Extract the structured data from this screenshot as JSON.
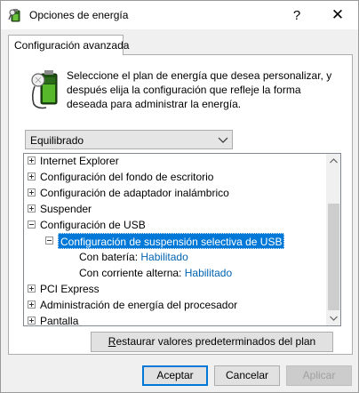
{
  "window": {
    "title": "Opciones de energía",
    "help_glyph": "?",
    "close_glyph": "✕"
  },
  "tab": {
    "label": "Configuración avanzada"
  },
  "description": "Seleccione el plan de energía que desea personalizar, y después elija la configuración que refleje la forma deseada para administrar la energía.",
  "plan_select": {
    "value": "Equilibrado"
  },
  "tree": {
    "items": [
      {
        "label": "Internet Explorer",
        "state": "collapsed"
      },
      {
        "label": "Configuración del fondo de escritorio",
        "state": "collapsed"
      },
      {
        "label": "Configuración de adaptador inalámbrico",
        "state": "collapsed"
      },
      {
        "label": "Suspender",
        "state": "collapsed"
      },
      {
        "label": "Configuración de USB",
        "state": "expanded"
      },
      {
        "label": "Configuración de suspensión selectiva de USB",
        "state": "expanded",
        "selected": true
      },
      {
        "label": "Con batería:",
        "value": "Habilitado"
      },
      {
        "label": "Con corriente alterna:",
        "value": "Habilitado"
      },
      {
        "label": "PCI Express",
        "state": "collapsed"
      },
      {
        "label": "Administración de energía del procesador",
        "state": "collapsed"
      },
      {
        "label": "Pantalla",
        "state": "collapsed"
      }
    ]
  },
  "buttons": {
    "restore_underlined": "R",
    "restore_rest": "estaurar valores predeterminados del plan",
    "ok": "Aceptar",
    "cancel": "Cancelar",
    "apply": "Aplicar"
  },
  "colors": {
    "selection": "#0078d7",
    "setting_value": "#0063b1",
    "focus_border": "#0078d7"
  }
}
